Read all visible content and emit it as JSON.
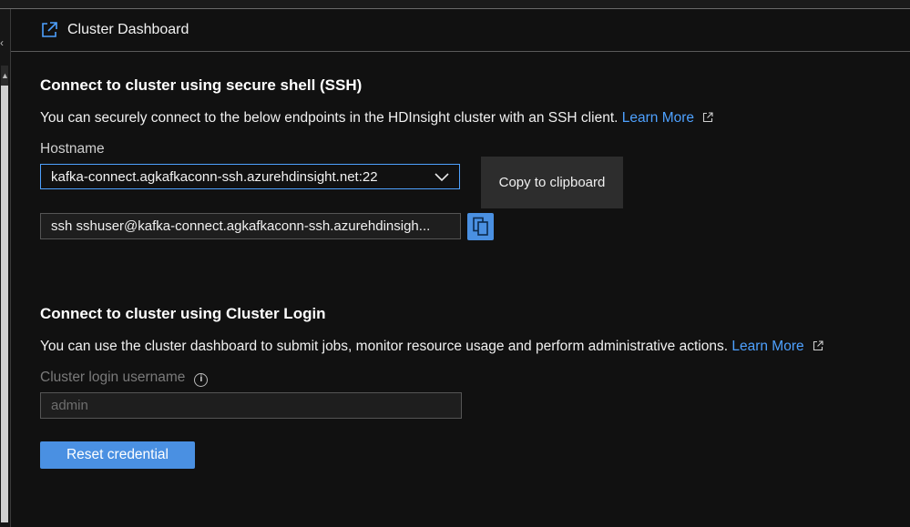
{
  "header": {
    "title": "Cluster Dashboard",
    "icon": "external-link-icon"
  },
  "ssh": {
    "title": "Connect to cluster using secure shell (SSH)",
    "description": "You can securely connect to the below endpoints in the HDInsight cluster with an SSH client.",
    "learn_more": "Learn More",
    "hostname_label": "Hostname",
    "hostname_value": "kafka-connect.agkafkaconn-ssh.azurehdinsight.net:22",
    "command_value": "ssh sshuser@kafka-connect.agkafkaconn-ssh.azurehdinsigh...",
    "tooltip": "Copy to clipboard"
  },
  "login": {
    "title": "Connect to cluster using Cluster Login",
    "description": "You can use the cluster dashboard to submit jobs, monitor resource usage and perform administrative actions.",
    "learn_more": "Learn More",
    "username_label": "Cluster login username",
    "username_value": "admin",
    "reset_button": "Reset credential"
  },
  "colors": {
    "accent": "#4a90e2",
    "link": "#4ea1ff",
    "background": "#111111"
  }
}
